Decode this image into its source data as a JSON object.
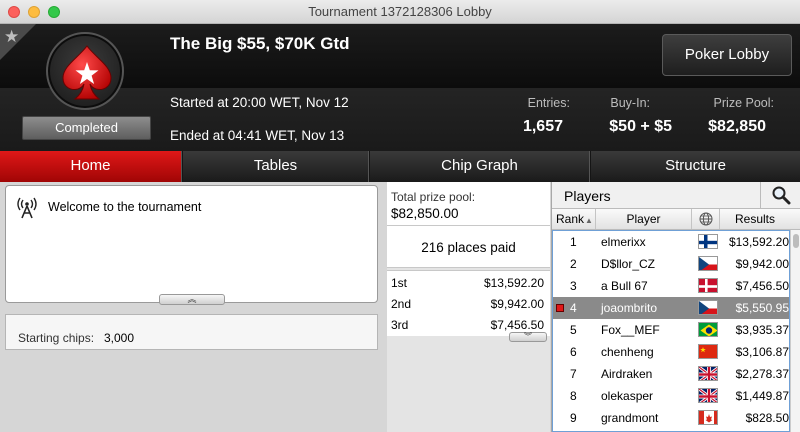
{
  "window": {
    "title": "Tournament 1372128306 Lobby"
  },
  "header": {
    "name": "The Big $55, $70K Gtd",
    "started": "Started at 20:00 WET, Nov 12",
    "ended": "Ended at 04:41 WET, Nov 13",
    "status": "Completed",
    "lobby_button": "Poker Lobby",
    "stats": {
      "entries_label": "Entries:",
      "entries": "1,657",
      "buyin_label": "Buy-In:",
      "buyin": "$50 + $5",
      "prizepool_label": "Prize Pool:",
      "prizepool": "$82,850"
    }
  },
  "tabs": [
    {
      "label": "Home"
    },
    {
      "label": "Tables"
    },
    {
      "label": "Chip Graph"
    },
    {
      "label": "Structure"
    }
  ],
  "home": {
    "welcome": "Welcome to the tournament",
    "starting_chips_label": "Starting chips:",
    "starting_chips": "3,000"
  },
  "prize": {
    "label": "Total prize pool:",
    "total": "$82,850.00",
    "places_paid": "216 places paid",
    "rows": [
      {
        "place": "1st",
        "amount": "$13,592.20"
      },
      {
        "place": "2nd",
        "amount": "$9,942.00"
      },
      {
        "place": "3rd",
        "amount": "$7,456.50"
      }
    ]
  },
  "players": {
    "title": "Players",
    "columns": {
      "rank": "Rank",
      "player": "Player",
      "results": "Results"
    },
    "rows": [
      {
        "rank": "1",
        "name": "elmerixx",
        "flag": "finland",
        "result": "$13,592.20"
      },
      {
        "rank": "2",
        "name": "D$llor_CZ",
        "flag": "czech",
        "result": "$9,942.00"
      },
      {
        "rank": "3",
        "name": "a Bull 67",
        "flag": "denmark",
        "result": "$7,456.50"
      },
      {
        "rank": "4",
        "name": "joaombrito",
        "flag": "czech",
        "result": "$5,550.95"
      },
      {
        "rank": "5",
        "name": "Fox__MEF",
        "flag": "brazil",
        "result": "$3,935.37"
      },
      {
        "rank": "6",
        "name": "chenheng",
        "flag": "china",
        "result": "$3,106.87"
      },
      {
        "rank": "7",
        "name": "Airdraken",
        "flag": "uk",
        "result": "$2,278.37"
      },
      {
        "rank": "8",
        "name": "olekasper",
        "flag": "uk",
        "result": "$1,449.87"
      },
      {
        "rank": "9",
        "name": "grandmont",
        "flag": "canada",
        "result": "$828.50"
      }
    ]
  },
  "colors": {
    "accent": "#d50d0d",
    "selected_row": "#8a8a8a"
  }
}
